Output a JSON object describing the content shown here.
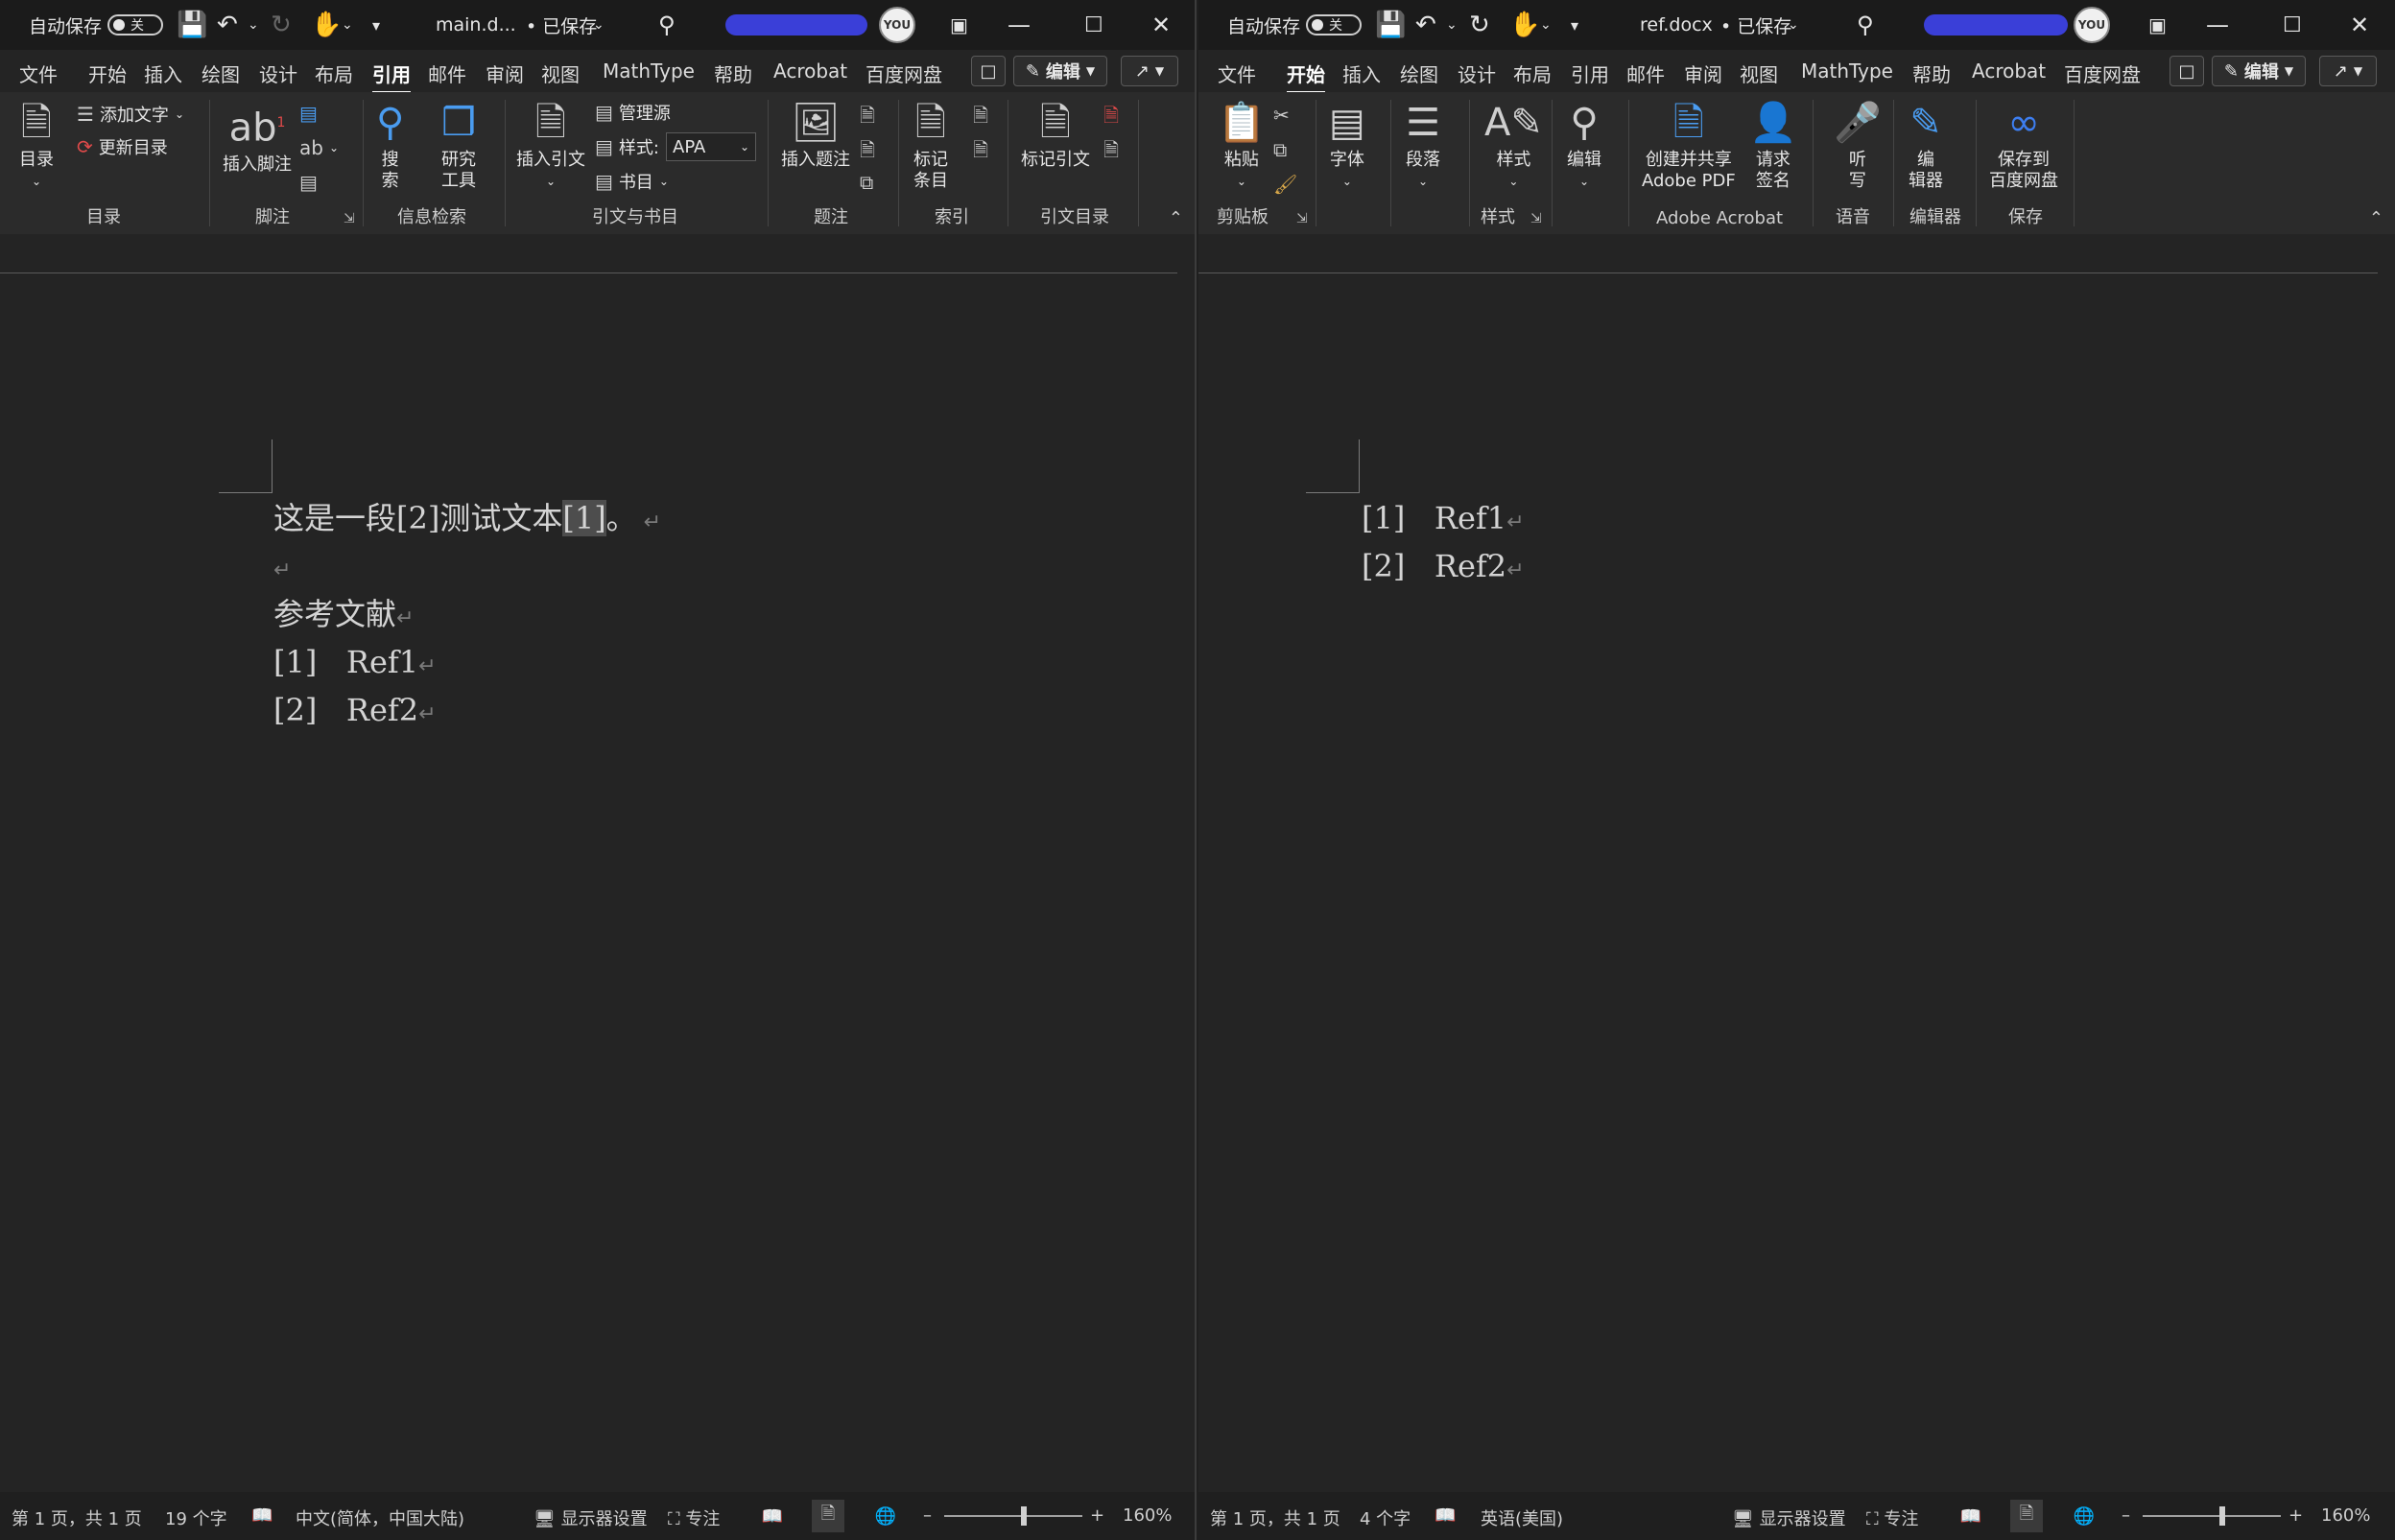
{
  "left": {
    "titlebar": {
      "autosave_label": "自动保存",
      "autosave_state": "关",
      "filename": "main.d...",
      "save_status": "• 已保存"
    },
    "tabs": [
      "文件",
      "开始",
      "插入",
      "绘图",
      "设计",
      "布局",
      "引用",
      "邮件",
      "审阅",
      "视图",
      "MathType",
      "帮助",
      "Acrobat",
      "百度网盘"
    ],
    "active_tab": "引用",
    "edit_label": "编辑",
    "ribbon": {
      "toc": {
        "btn": "目录",
        "add_text": "添加文字",
        "update_toc": "更新目录",
        "group": "目录"
      },
      "footnotes": {
        "insert": "插入脚注",
        "group": "脚注"
      },
      "research": {
        "search": "搜\n索",
        "tools": "研究\n工具",
        "group": "信息检索"
      },
      "citations": {
        "insert": "插入引文",
        "manage": "管理源",
        "style_label": "样式:",
        "style_value": "APA",
        "biblio": "书目",
        "group": "引文与书目"
      },
      "captions": {
        "insert": "插入题注",
        "group": "题注"
      },
      "index": {
        "mark": "标记\n条目",
        "group": "索引"
      },
      "toa": {
        "mark": "标记引文",
        "group": "引文目录"
      }
    },
    "document": {
      "line1_before": "这是一段[2]测试文本",
      "line1_field": "[1]",
      "line1_after": "。",
      "heading": "参考文献",
      "refs": [
        {
          "num": "[1]",
          "text": "Ref1"
        },
        {
          "num": "[2]",
          "text": "Ref2"
        }
      ]
    },
    "status": {
      "page": "第 1 页，共 1 页",
      "words": "19 个字",
      "language": "中文(简体，中国大陆)",
      "display": "显示器设置",
      "focus": "专注",
      "zoom": "160%"
    }
  },
  "right": {
    "titlebar": {
      "autosave_label": "自动保存",
      "autosave_state": "关",
      "filename": "ref.docx",
      "save_status": "• 已保存"
    },
    "tabs": [
      "文件",
      "开始",
      "插入",
      "绘图",
      "设计",
      "布局",
      "引用",
      "邮件",
      "审阅",
      "视图",
      "MathType",
      "帮助",
      "Acrobat",
      "百度网盘"
    ],
    "active_tab": "开始",
    "edit_label": "编辑",
    "ribbon": {
      "clipboard": {
        "paste": "粘贴",
        "group": "剪贴板"
      },
      "font": {
        "btn": "字体"
      },
      "paragraph": {
        "btn": "段落"
      },
      "styles": {
        "btn": "样式",
        "group": "样式"
      },
      "editing": {
        "btn": "编辑"
      },
      "acrobat": {
        "create": "创建并共享\nAdobe PDF",
        "sign": "请求\n签名",
        "group": "Adobe Acrobat"
      },
      "voice": {
        "dictate": "听\n写",
        "group": "语音"
      },
      "editor": {
        "btn": "编\n辑器",
        "group": "编辑器"
      },
      "save": {
        "btn": "保存到\n百度网盘",
        "group": "保存"
      }
    },
    "document": {
      "refs": [
        {
          "num": "[1]",
          "text": "Ref1"
        },
        {
          "num": "[2]",
          "text": "Ref2"
        }
      ]
    },
    "status": {
      "page": "第 1 页，共 1 页",
      "words": "4 个字",
      "language": "英语(美国)",
      "display": "显示器设置",
      "focus": "专注",
      "zoom": "160%"
    }
  }
}
